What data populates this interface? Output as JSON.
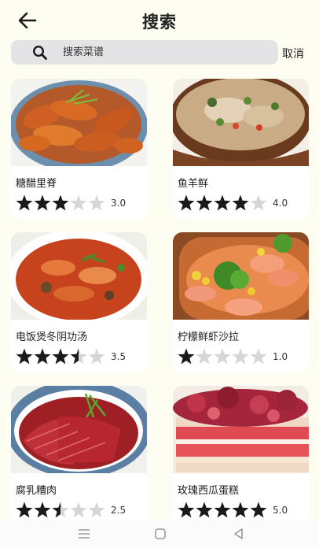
{
  "header": {
    "title": "搜索",
    "back_icon": "arrow-left-icon"
  },
  "search": {
    "placeholder": "搜索菜谱",
    "value": "",
    "icon": "search-icon",
    "cancel_label": "取消"
  },
  "recipes": [
    {
      "name": "糖醋里脊",
      "rating": 3.0,
      "rating_text": "3.0",
      "image": "sweet-sour-pork-image"
    },
    {
      "name": "鱼羊鲜",
      "rating": 4.0,
      "rating_text": "4.0",
      "image": "fish-lamb-stew-image"
    },
    {
      "name": "电饭煲冬阴功汤",
      "rating": 3.5,
      "rating_text": "3.5",
      "image": "tom-yum-soup-image"
    },
    {
      "name": "柠檬鲜虾沙拉",
      "rating": 1.0,
      "rating_text": "1.0",
      "image": "lemon-shrimp-salad-image"
    },
    {
      "name": "腐乳糟肉",
      "rating": 2.5,
      "rating_text": "2.5",
      "image": "fermented-tofu-pork-image"
    },
    {
      "name": "玫瑰西瓜蛋糕",
      "rating": 5.0,
      "rating_text": "5.0",
      "image": "rose-watermelon-cake-image"
    }
  ],
  "colors": {
    "background": "#fdfdf1",
    "search_bg": "#e4e4e6",
    "star_filled": "#1a1a1a",
    "star_empty": "#d6d6d6"
  },
  "navbar": {
    "icons": [
      "menu-icon",
      "home-square-icon",
      "back-triangle-icon"
    ]
  }
}
